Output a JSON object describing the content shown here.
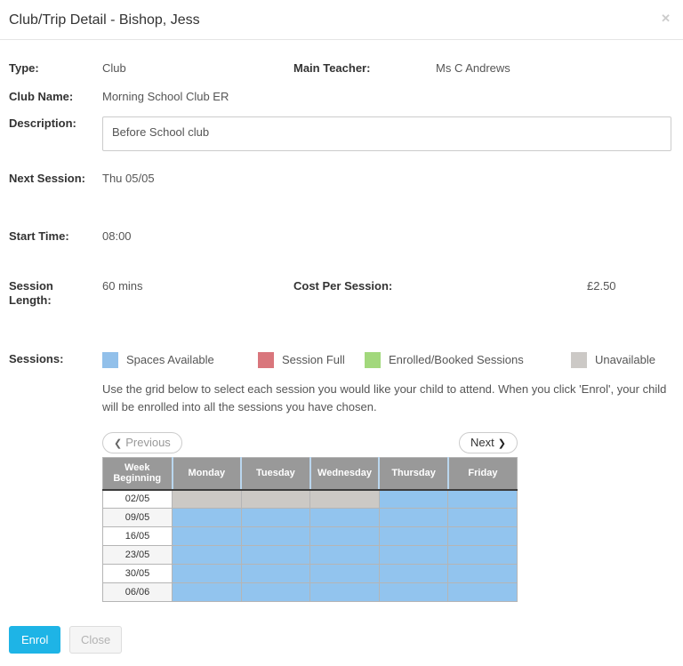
{
  "modal": {
    "title": "Club/Trip Detail - Bishop, Jess",
    "close_icon": "✕"
  },
  "fields": {
    "type_label": "Type:",
    "type_value": "Club",
    "main_teacher_label": "Main Teacher:",
    "main_teacher_value": "Ms C Andrews",
    "club_name_label": "Club Name:",
    "club_name_value": "Morning School Club ER",
    "description_label": "Description:",
    "description_value": "Before School club",
    "next_session_label": "Next Session:",
    "next_session_value": "Thu 05/05",
    "start_time_label": "Start Time:",
    "start_time_value": "08:00",
    "session_length_label": "Session Length:",
    "session_length_value": "60 mins",
    "cost_label": "Cost Per Session:",
    "cost_value": "£2.50",
    "sessions_label": "Sessions:"
  },
  "legend": {
    "items": [
      {
        "label": "Spaces Available",
        "state": "available",
        "color": "#92c0ea"
      },
      {
        "label": "Session Full",
        "state": "full",
        "color": "#d9767c"
      },
      {
        "label": "Enrolled/Booked Sessions",
        "state": "booked",
        "color": "#a2d87c"
      },
      {
        "label": "Unavailable",
        "state": "unavailable",
        "color": "#ccc9c6"
      }
    ]
  },
  "instructions": "Use the grid below to select each session you would like your child to attend. When you click 'Enrol', your child will be enrolled into all the sessions you have chosen.",
  "pager": {
    "previous_label": "Previous",
    "previous_icon": "❮",
    "next_label": "Next",
    "next_icon": "❯"
  },
  "grid": {
    "columns": [
      "Week Beginning",
      "Monday",
      "Tuesday",
      "Wednesday",
      "Thursday",
      "Friday"
    ],
    "state_colors": {
      "available": "#92c4ee",
      "full": "#d9767c",
      "booked": "#a2d87c",
      "unavailable": "#ccc9c5"
    },
    "rows": [
      {
        "week": "02/05",
        "cells": [
          "unavailable",
          "unavailable",
          "unavailable",
          "available",
          "available"
        ]
      },
      {
        "week": "09/05",
        "cells": [
          "available",
          "available",
          "available",
          "available",
          "available"
        ]
      },
      {
        "week": "16/05",
        "cells": [
          "available",
          "available",
          "available",
          "available",
          "available"
        ]
      },
      {
        "week": "23/05",
        "cells": [
          "available",
          "available",
          "available",
          "available",
          "available"
        ]
      },
      {
        "week": "30/05",
        "cells": [
          "available",
          "available",
          "available",
          "available",
          "available"
        ]
      },
      {
        "week": "06/06",
        "cells": [
          "available",
          "available",
          "available",
          "available",
          "available"
        ]
      }
    ]
  },
  "footer": {
    "enrol_label": "Enrol",
    "enrol_color": "#1eb4e6",
    "close_label": "Close"
  }
}
